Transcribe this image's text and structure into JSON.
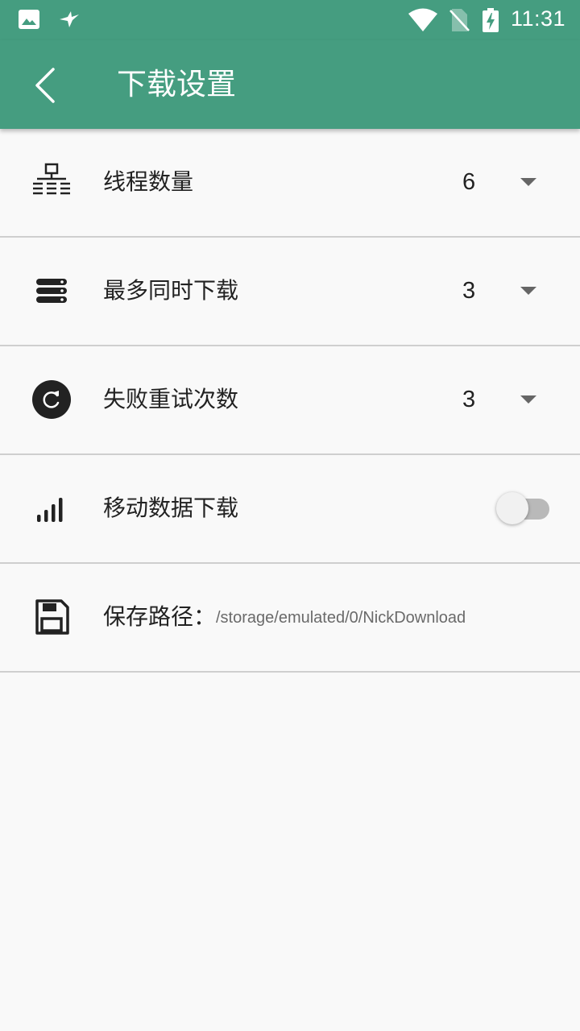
{
  "status_bar": {
    "time": "11:31",
    "icons": [
      "image-notification-icon",
      "bird-notification-icon",
      "wifi-icon",
      "no-sim-icon",
      "battery-charging-icon"
    ]
  },
  "app_bar": {
    "title": "下载设置",
    "back_icon": "chevron-left-icon"
  },
  "settings": [
    {
      "icon": "network-icon",
      "label": "线程数量",
      "value": "6",
      "control": "dropdown"
    },
    {
      "icon": "stack-icon",
      "label": "最多同时下载",
      "value": "3",
      "control": "dropdown"
    },
    {
      "icon": "retry-icon",
      "label": "失败重试次数",
      "value": "3",
      "control": "dropdown"
    },
    {
      "icon": "signal-icon",
      "label": "移动数据下载",
      "control": "switch",
      "switch_on": false
    },
    {
      "icon": "save-icon",
      "label": "保存路径：",
      "path": "/storage/emulated/0/NickDownload"
    }
  ],
  "colors": {
    "primary": "#459d80",
    "background": "#f9f9f9",
    "divider": "#cfcfcf",
    "text": "#222222",
    "secondary_text": "#6a6a6a"
  }
}
